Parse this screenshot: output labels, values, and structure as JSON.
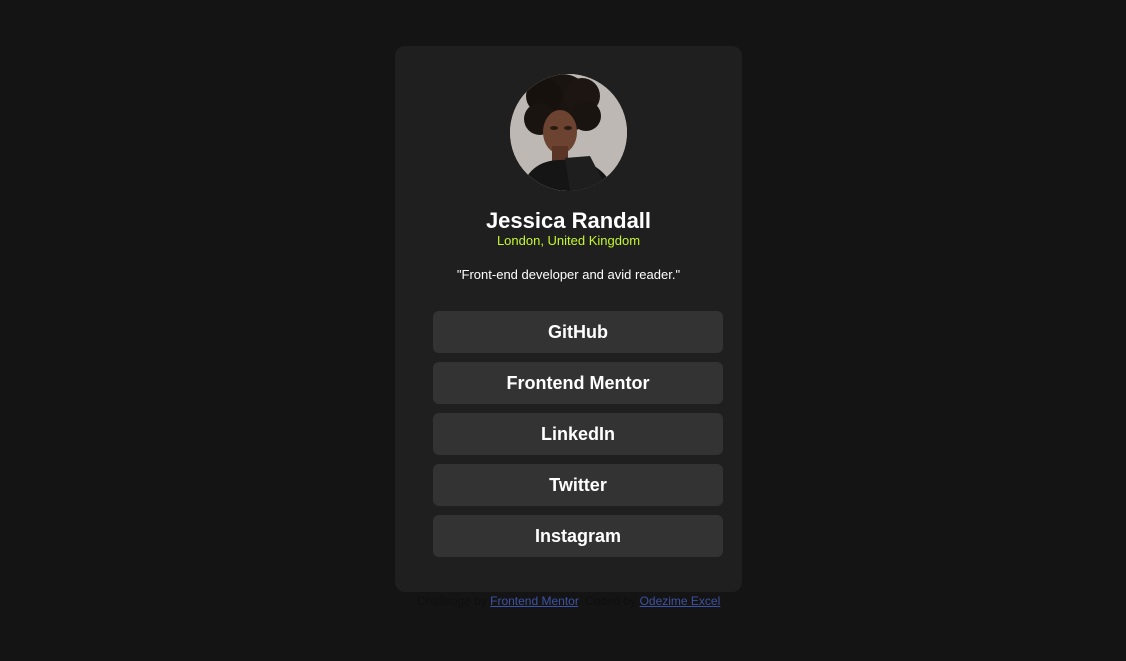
{
  "profile": {
    "avatar_icon": "profile-photo",
    "name": "Jessica Randall",
    "location": "London, United Kingdom",
    "bio": "\"Front-end developer and avid reader.\""
  },
  "links": [
    {
      "label": "GitHub"
    },
    {
      "label": "Frontend Mentor"
    },
    {
      "label": "LinkedIn"
    },
    {
      "label": "Twitter"
    },
    {
      "label": "Instagram"
    }
  ],
  "attribution": {
    "challenge_prefix": "Challenge by",
    "challenge_link": "Frontend Mentor",
    "separator": ". Coded by",
    "author_link": "Odezime Excel",
    "text_color": "#0f0f0f",
    "link_color": "#3e52a3"
  },
  "colors": {
    "background": "#141414",
    "card": "#1f1f1f",
    "button": "#333333",
    "accent": "#c4f82a",
    "text": "#ffffff"
  }
}
